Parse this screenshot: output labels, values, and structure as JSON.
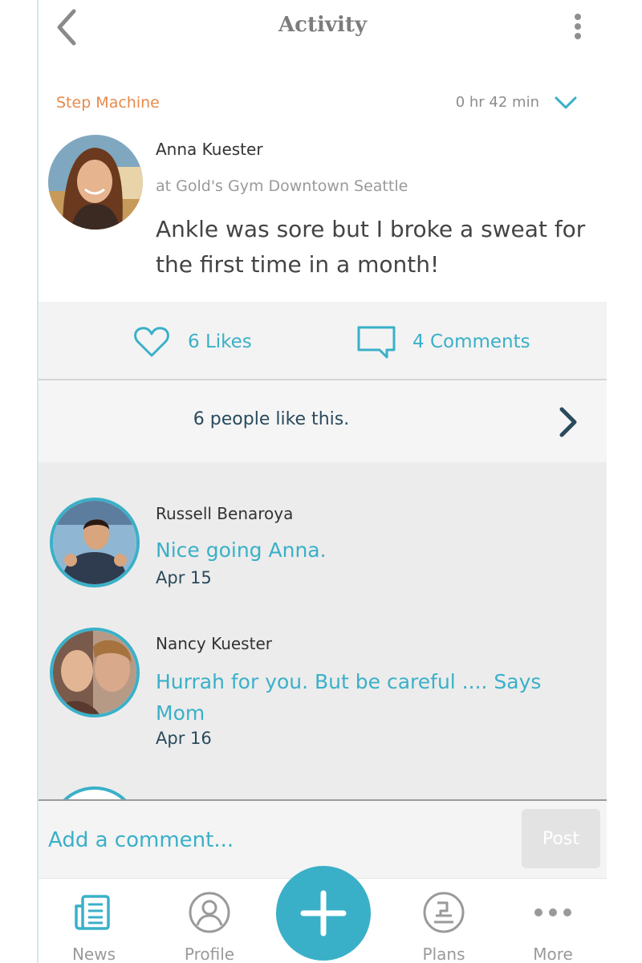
{
  "header": {
    "title": "Activity"
  },
  "post": {
    "activity_type": "Step Machine",
    "duration": "0 hr 42 min",
    "author": "Anna Kuester",
    "location": "at Gold's Gym Downtown Seattle",
    "text": "Ankle was sore but I broke a sweat for the first time in a month!"
  },
  "actions": {
    "likes_label": "6 Likes",
    "comments_label": "4 Comments"
  },
  "likes_summary": "6 people like this.",
  "comments": [
    {
      "name": "Russell Benaroya",
      "text": "Nice going Anna.",
      "date": "Apr 15"
    },
    {
      "name": "Nancy Kuester",
      "text": "Hurrah for you. But be careful .... Says Mom",
      "date": "Apr 16"
    }
  ],
  "comment_input": {
    "placeholder": "Add a comment...",
    "post_label": "Post"
  },
  "nav": {
    "items": [
      {
        "label": "News"
      },
      {
        "label": "Profile"
      },
      {
        "label": "Plans"
      },
      {
        "label": "More"
      }
    ]
  },
  "colors": {
    "accent": "#3ab0c8",
    "activity_orange": "#e8894a",
    "dark_text": "#2a4a5c"
  }
}
